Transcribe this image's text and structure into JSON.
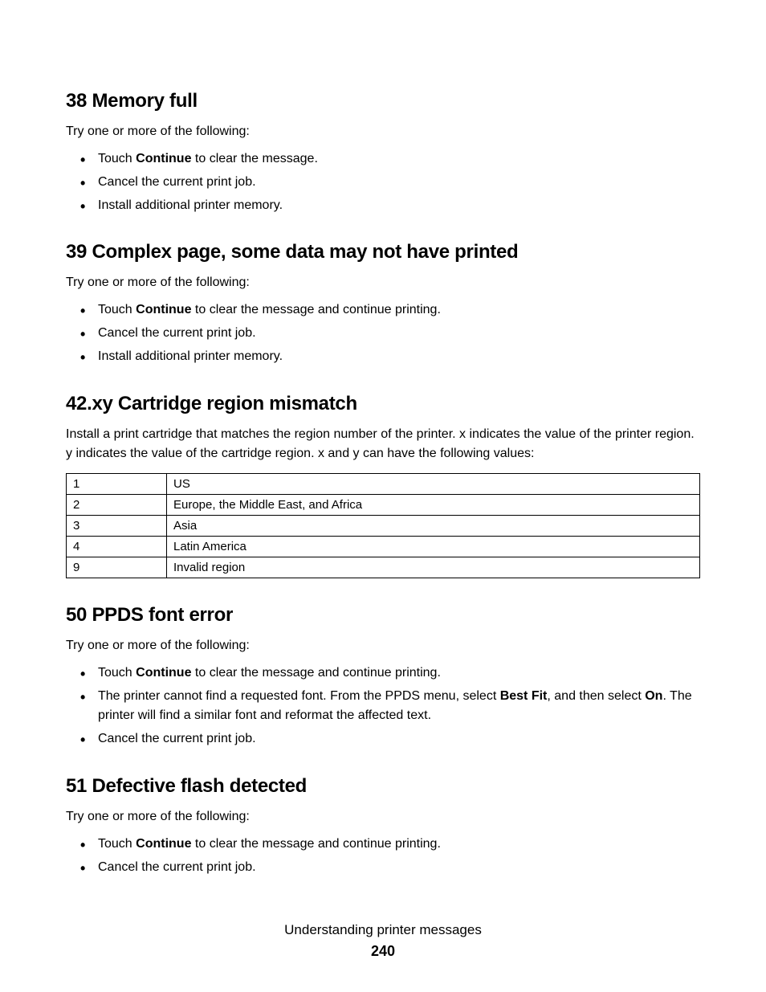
{
  "sections": {
    "s38": {
      "heading": "38 Memory full",
      "intro": "Try one or more of the following:",
      "b1_pre": "Touch ",
      "b1_bold": "Continue",
      "b1_post": " to clear the message.",
      "b2": "Cancel the current print job.",
      "b3": "Install additional printer memory."
    },
    "s39": {
      "heading": "39 Complex page, some data may not have printed",
      "intro": "Try one or more of the following:",
      "b1_pre": "Touch ",
      "b1_bold": "Continue",
      "b1_post": " to clear the message and continue printing.",
      "b2": "Cancel the current print job.",
      "b3": "Install additional printer memory."
    },
    "s42": {
      "heading": "42.xy Cartridge region mismatch",
      "body": "Install a print cartridge that matches the region number of the printer. x indicates the value of the printer region. y indicates the value of the cartridge region. x and y can have the following values:",
      "table": [
        {
          "code": "1",
          "region": "US"
        },
        {
          "code": "2",
          "region": "Europe, the Middle East, and Africa"
        },
        {
          "code": "3",
          "region": "Asia"
        },
        {
          "code": "4",
          "region": "Latin America"
        },
        {
          "code": "9",
          "region": "Invalid region"
        }
      ]
    },
    "s50": {
      "heading": "50 PPDS font error",
      "intro": "Try one or more of the following:",
      "b1_pre": "Touch ",
      "b1_bold": "Continue",
      "b1_post": " to clear the message and continue printing.",
      "b2_pre": "The printer cannot find a requested font. From the PPDS menu, select ",
      "b2_bold1": "Best Fit",
      "b2_mid": ", and then select ",
      "b2_bold2": "On",
      "b2_post": ". The printer will find a similar font and reformat the affected text.",
      "b3": "Cancel the current print job."
    },
    "s51": {
      "heading": "51 Defective flash detected",
      "intro": "Try one or more of the following:",
      "b1_pre": "Touch ",
      "b1_bold": "Continue",
      "b1_post": " to clear the message and continue printing.",
      "b2": "Cancel the current print job."
    }
  },
  "footer": {
    "title": "Understanding printer messages",
    "page": "240"
  }
}
